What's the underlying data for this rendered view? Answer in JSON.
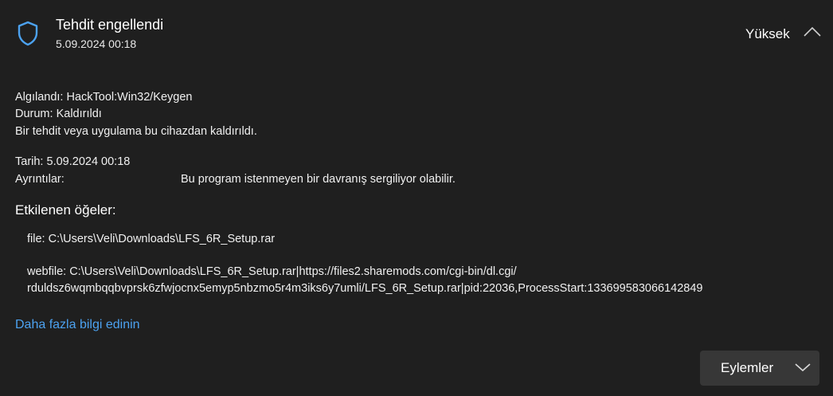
{
  "header": {
    "title": "Tehdit engellendi",
    "datetime": "5.09.2024 00:18",
    "severity": "Yüksek",
    "shield_icon": "shield-icon",
    "collapse_icon": "chevron-up-icon"
  },
  "details": {
    "detected_label": "Algılandı:",
    "detected_value": "HackTool:Win32/Keygen",
    "status_label": "Durum:",
    "status_value": "Kaldırıldı",
    "status_message": "Bir tehdit veya uygulama bu cihazdan kaldırıldı.",
    "date_label": "Tarih:",
    "date_value": "5.09.2024 00:18",
    "details_label": "Ayrıntılar:",
    "details_value": "Bu program istenmeyen bir davranış sergiliyor olabilir."
  },
  "affected": {
    "heading": "Etkilenen öğeler:",
    "file_line": "file: C:\\Users\\Veli\\Downloads\\LFS_6R_Setup.rar",
    "webfile_line1": "webfile: C:\\Users\\Veli\\Downloads\\LFS_6R_Setup.rar|https://files2.sharemods.com/cgi-bin/dl.cgi/",
    "webfile_line2": "rduldsz6wqmbqqbvprsk6zfwjocnx5emyp5nbzmo5r4m3iks6y7umli/LFS_6R_Setup.rar|pid:22036,ProcessStart:133699583066142849"
  },
  "learn_more": "Daha fazla bilgi edinin",
  "actions_button": {
    "label": "Eylemler",
    "icon": "chevron-down-icon"
  },
  "colors": {
    "background": "#1f1f1f",
    "accent": "#4ca2f0",
    "button_bg": "#373737"
  }
}
